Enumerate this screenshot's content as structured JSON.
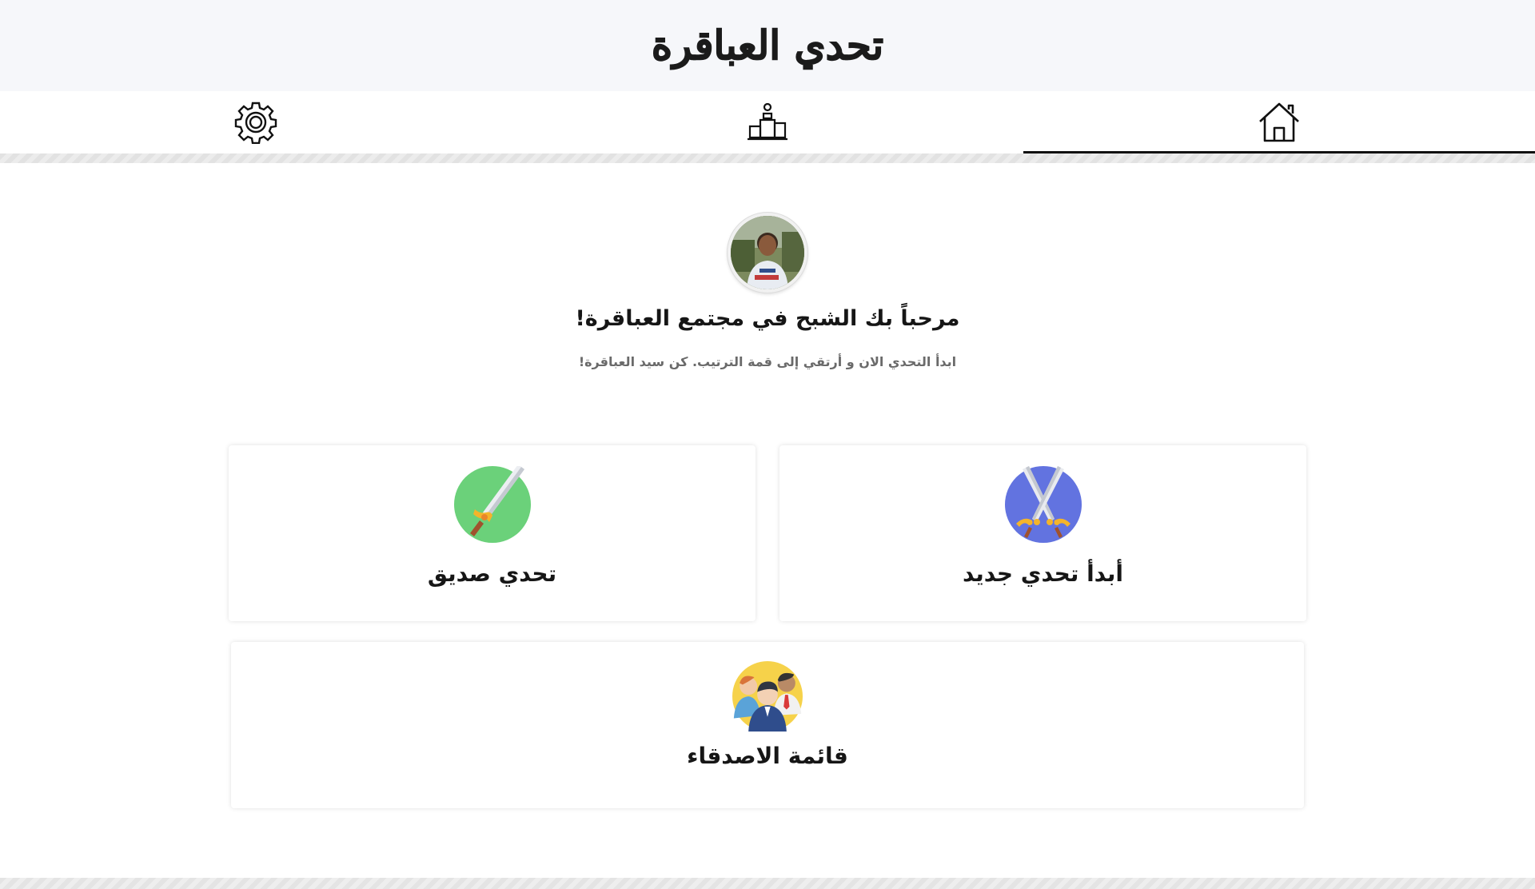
{
  "header": {
    "title": "تحدي العباقرة"
  },
  "nav": {
    "tabs": [
      {
        "name": "settings",
        "icon": "gear-icon",
        "active": false
      },
      {
        "name": "leaderboard",
        "icon": "podium-icon",
        "active": false
      },
      {
        "name": "home",
        "icon": "home-icon",
        "active": true
      }
    ]
  },
  "welcome": {
    "avatar_icon": "user-avatar",
    "title": "مرحباً بك الشبح في مجتمع العباقرة!",
    "subtitle": "ابدأ التحدي الان و أرتقي إلى قمة الترتيب. كن سيد العباقرة!"
  },
  "cards": {
    "new_challenge": {
      "label": "أبدأ تحدي جديد",
      "icon": "crossed-swords-icon",
      "color": "#6273e0"
    },
    "challenge_friend": {
      "label": "تحدي صديق",
      "icon": "sword-icon",
      "color": "#6bd17a"
    },
    "friends_list": {
      "label": "قائمة الاصدقاء",
      "icon": "friends-group-icon",
      "color": "#f6d24a"
    }
  },
  "colors": {
    "header_bg": "#f6f7fa",
    "active_tab_underline": "#111111",
    "text": "#161616",
    "subtitle_text": "#6a6a6a"
  }
}
